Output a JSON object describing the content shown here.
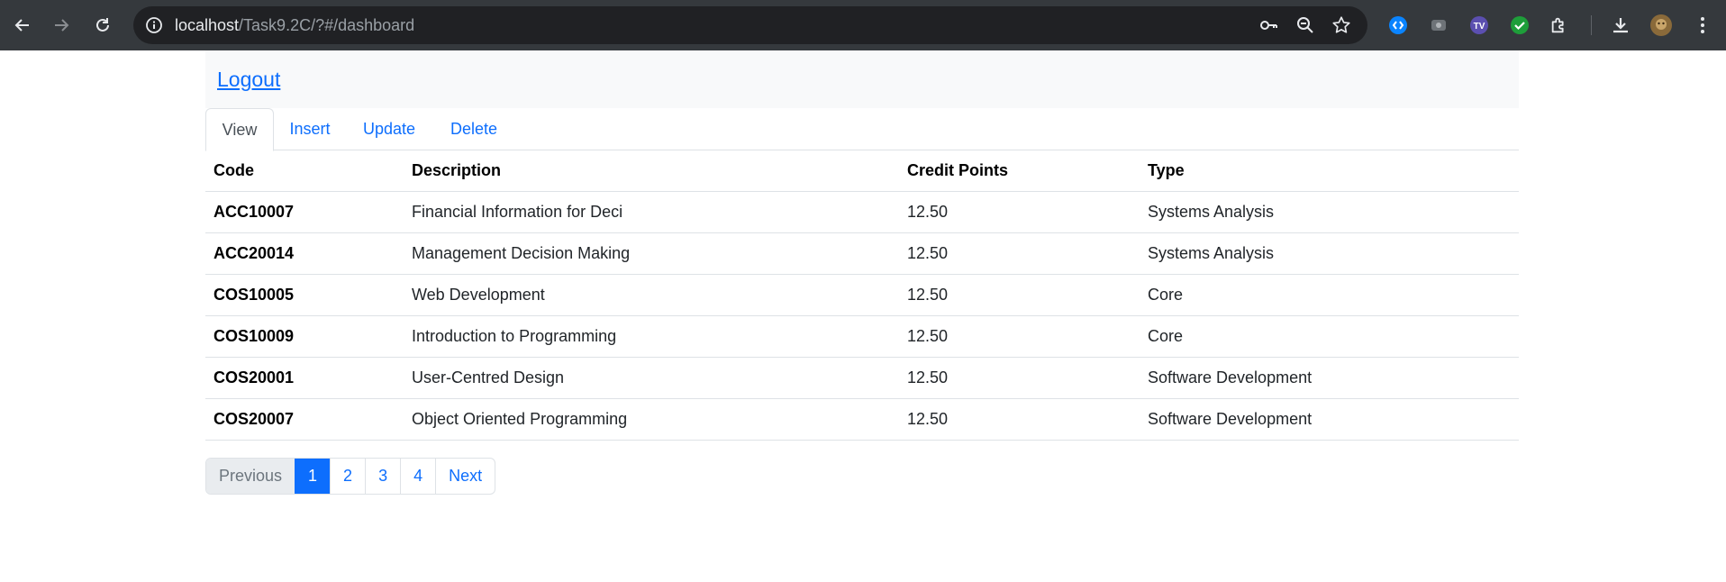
{
  "browser": {
    "url_host": "localhost",
    "url_path": "/Task9.2C/?#/dashboard"
  },
  "header": {
    "logout_label": "Logout"
  },
  "tabs": [
    {
      "label": "View",
      "active": true
    },
    {
      "label": "Insert",
      "active": false
    },
    {
      "label": "Update",
      "active": false
    },
    {
      "label": "Delete",
      "active": false
    }
  ],
  "table": {
    "headers": [
      "Code",
      "Description",
      "Credit Points",
      "Type"
    ],
    "rows": [
      [
        "ACC10007",
        "Financial Information for Deci",
        "12.50",
        "Systems Analysis"
      ],
      [
        "ACC20014",
        "Management Decision Making",
        "12.50",
        "Systems Analysis"
      ],
      [
        "COS10005",
        "Web Development",
        "12.50",
        "Core"
      ],
      [
        "COS10009",
        "Introduction to Programming",
        "12.50",
        "Core"
      ],
      [
        "COS20001",
        "User-Centred Design",
        "12.50",
        "Software Development"
      ],
      [
        "COS20007",
        "Object Oriented Programming",
        "12.50",
        "Software Development"
      ]
    ]
  },
  "pagination": {
    "previous": "Previous",
    "pages": [
      "1",
      "2",
      "3",
      "4"
    ],
    "current": "1",
    "next": "Next"
  },
  "colors": {
    "accent": "#0d6efd",
    "chrome_bg": "#35393d",
    "omnibox_bg": "#202124"
  },
  "icons": {
    "back": "arrow-left-icon",
    "forward": "arrow-right-icon",
    "reload": "reload-icon",
    "site_info": "info-icon",
    "password": "key-icon",
    "zoom": "zoom-out-icon",
    "bookmark": "star-icon",
    "extensions": [
      "shazam-icon",
      "camera-ext-icon",
      "tv-ext-icon",
      "check-ext-icon",
      "puzzle-icon"
    ],
    "download": "download-icon",
    "profile": "avatar",
    "menu": "kebab-menu-icon"
  }
}
